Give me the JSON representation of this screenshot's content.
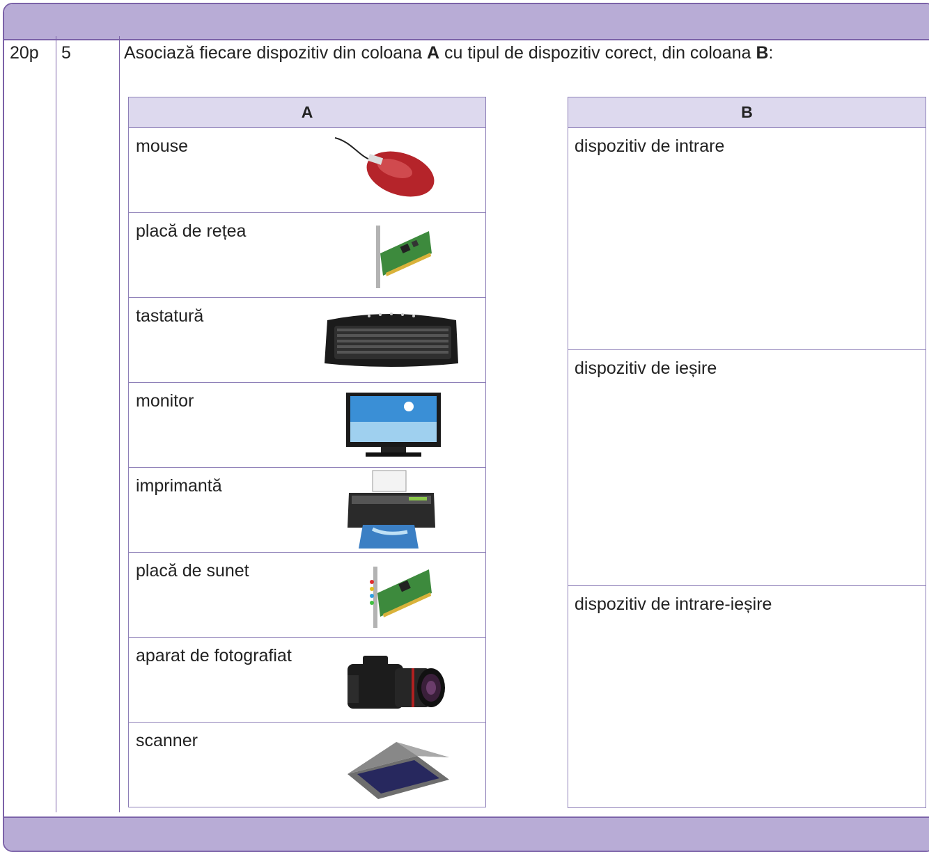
{
  "exercise": {
    "points": "20p",
    "number": "5",
    "instruction_parts": [
      "Asociază fiecare dispozitiv din coloana ",
      "A",
      " cu tipul de dispozitiv corect, din coloana ",
      "B",
      ":"
    ]
  },
  "column_a": {
    "header": "A",
    "items": [
      {
        "label": "mouse",
        "icon": "mouse-icon"
      },
      {
        "label": "placă de rețea",
        "icon": "network-card-icon"
      },
      {
        "label": "tastatură",
        "icon": "keyboard-icon"
      },
      {
        "label": "monitor",
        "icon": "monitor-icon"
      },
      {
        "label": "imprimantă",
        "icon": "printer-icon"
      },
      {
        "label": "placă de sunet",
        "icon": "sound-card-icon"
      },
      {
        "label": "aparat de fotografiat",
        "icon": "camera-icon"
      },
      {
        "label": "scanner",
        "icon": "scanner-icon"
      }
    ]
  },
  "column_b": {
    "header": "B",
    "items": [
      {
        "label": "dispozitiv de intrare"
      },
      {
        "label": "dispozitiv de ieșire"
      },
      {
        "label": "dispozitiv de intrare-ieșire"
      }
    ]
  },
  "colors": {
    "band": "#b8acd6",
    "border": "#7b62a8",
    "header_fill": "#ddd9ee"
  }
}
